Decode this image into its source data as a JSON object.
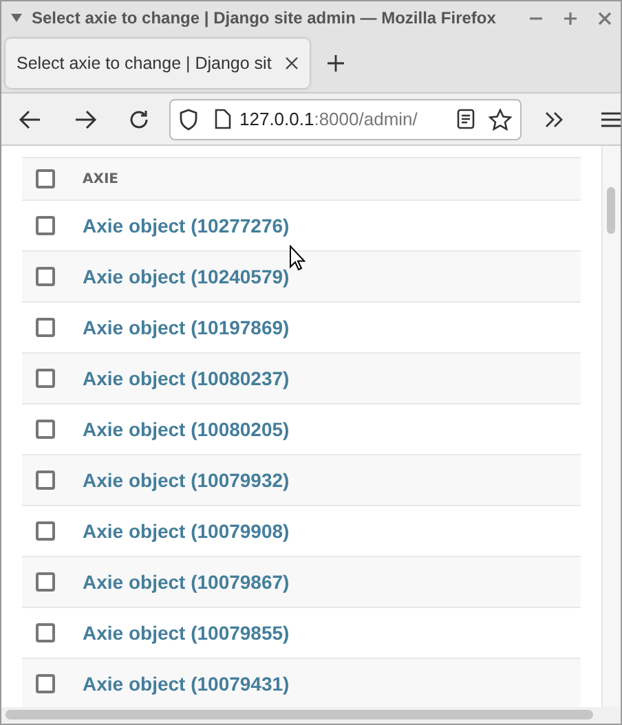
{
  "window": {
    "title": "Select axie to change | Django site admin — Mozilla Firefox"
  },
  "tabs": [
    {
      "label": "Select axie to change | Django sit",
      "selected": true
    }
  ],
  "address_bar": {
    "host": "127.0.0.1",
    "path": ":8000/admin/"
  },
  "table": {
    "header": {
      "label": "AXIE",
      "checked": false
    },
    "rows": [
      {
        "label": "Axie object (10277276)",
        "checked": false
      },
      {
        "label": "Axie object (10240579)",
        "checked": false
      },
      {
        "label": "Axie object (10197869)",
        "checked": false
      },
      {
        "label": "Axie object (10080237)",
        "checked": false
      },
      {
        "label": "Axie object (10080205)",
        "checked": false
      },
      {
        "label": "Axie object (10079932)",
        "checked": false
      },
      {
        "label": "Axie object (10079908)",
        "checked": false
      },
      {
        "label": "Axie object (10079867)",
        "checked": false
      },
      {
        "label": "Axie object (10079855)",
        "checked": false
      },
      {
        "label": "Axie object (10079431)",
        "checked": false
      }
    ]
  }
}
